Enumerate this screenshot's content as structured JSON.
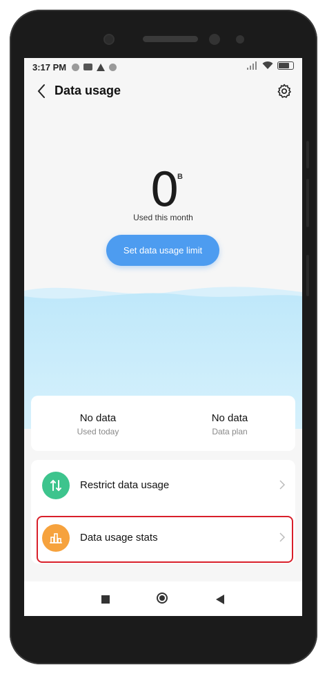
{
  "status": {
    "time": "3:17 PM"
  },
  "header": {
    "title": "Data usage"
  },
  "usage": {
    "value": "0",
    "unit": "B",
    "label": "Used this month",
    "limit_button": "Set data usage limit"
  },
  "stats": [
    {
      "value": "No data",
      "label": "Used today"
    },
    {
      "value": "No data",
      "label": "Data plan"
    }
  ],
  "menu": [
    {
      "label": "Restrict data usage",
      "icon": "restrict-data-icon",
      "color": "#3dc48d"
    },
    {
      "label": "Data usage stats",
      "icon": "stats-chart-icon",
      "color": "#f6a23d",
      "highlighted": true
    }
  ],
  "colors": {
    "accent": "#4d9cf0",
    "wave": "#c6ecfb",
    "highlight_border": "#d81f2a"
  }
}
